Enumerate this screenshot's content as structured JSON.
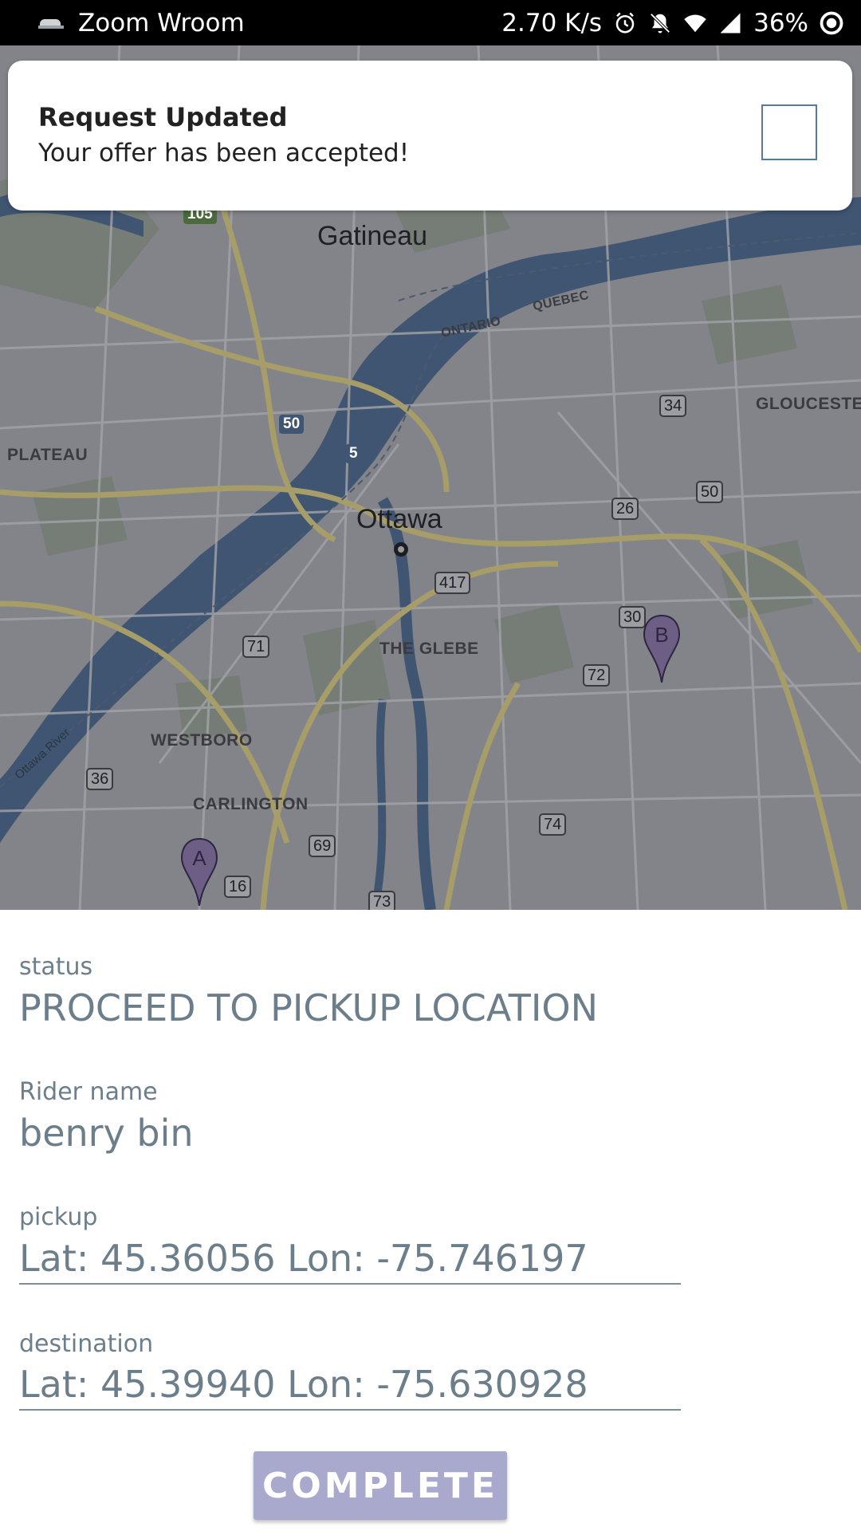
{
  "status_bar": {
    "app_name": "Zoom Wroom",
    "network_speed": "2.70 K/s",
    "battery": "36%",
    "icons": [
      "car-icon",
      "alarm-icon",
      "notifications-off-icon",
      "wifi-icon",
      "signal-icon",
      "battery-icon"
    ]
  },
  "notification": {
    "title": "Request Updated",
    "body": "Your offer has been accepted!"
  },
  "map": {
    "places": {
      "gatineau": "Gatineau",
      "ottawa": "Ottawa",
      "plateau": "PLATEAU",
      "gloucester": "GLOUCESTER",
      "glebe": "THE GLEBE",
      "westboro": "WESTBORO",
      "carlington": "CARLINGTON",
      "ontario": "ONTARIO",
      "quebec": "QUEBEC",
      "ottawa_river": "Ottawa River"
    },
    "roads": {
      "r105": "105",
      "r50a": "50",
      "r5": "5",
      "r34": "34",
      "r50b": "50",
      "r26": "26",
      "r417": "417",
      "r30": "30",
      "r71": "71",
      "r72": "72",
      "r36": "36",
      "r74": "74",
      "r69": "69",
      "r16": "16",
      "r73": "73"
    },
    "markers": {
      "pickup": "A",
      "destination": "B"
    }
  },
  "details": {
    "status_label": "status",
    "status_value": "PROCEED TO PICKUP LOCATION",
    "rider_label": "Rider name",
    "rider_value": "benry bin",
    "pickup_label": "pickup",
    "pickup_value": "Lat: 45.36056  Lon: -75.746197",
    "destination_label": "destination",
    "destination_value": "Lat: 45.39940  Lon: -75.630928"
  },
  "complete_button": "COMPLETE",
  "colors": {
    "text_muted": "#6b7e8a",
    "button_bg": "#a9a9cd",
    "map_overlay": "#828388",
    "water": "#3f5572"
  }
}
